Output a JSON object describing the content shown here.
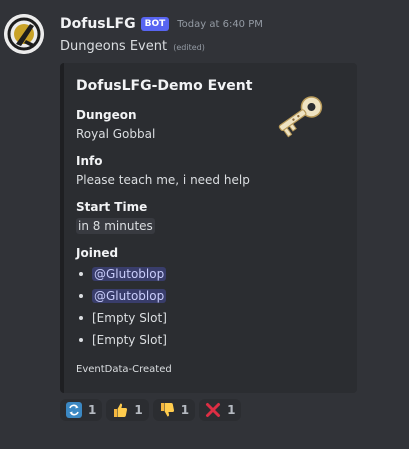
{
  "message": {
    "username": "DofusLFG",
    "bot_tag": "BOT",
    "timestamp": "Today at 6:40 PM",
    "content": "Dungeons Event",
    "edited_label": "(edited)"
  },
  "embed": {
    "title": "DofusLFG-Demo Event",
    "thumbnail_icon": "key-icon",
    "fields": {
      "dungeon": {
        "name": "Dungeon",
        "value": "Royal Gobbal"
      },
      "info": {
        "name": "Info",
        "value": "Please teach me, i need help"
      },
      "start_time": {
        "name": "Start Time",
        "value": "in 8 minutes"
      },
      "joined": {
        "name": "Joined",
        "items": [
          "@Glutoblop",
          "@Glutoblop",
          "[Empty Slot]",
          "[Empty Slot]"
        ]
      }
    },
    "footer": "EventData-Created"
  },
  "reactions": [
    {
      "emoji": "repeat-arrows-icon",
      "count": "1"
    },
    {
      "emoji": "thumbs-up-icon",
      "count": "1"
    },
    {
      "emoji": "thumbs-down-icon",
      "count": "1"
    },
    {
      "emoji": "red-x-icon",
      "count": "1"
    }
  ],
  "colors": {
    "background": "#313338",
    "embed_background": "#2b2d31",
    "bot_tag": "#5865f2",
    "mention_text": "#c9cdfb"
  }
}
